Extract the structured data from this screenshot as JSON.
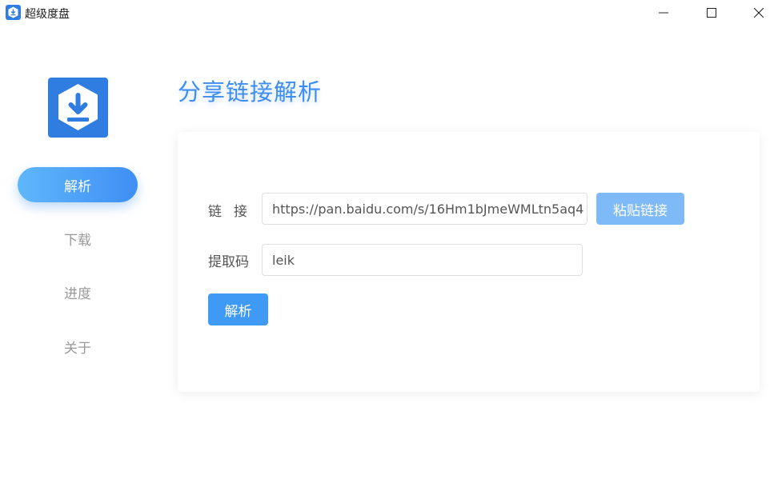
{
  "window": {
    "title": "超级度盘"
  },
  "sidebar": {
    "items": [
      {
        "label": "解析",
        "active": true
      },
      {
        "label": "下载",
        "active": false
      },
      {
        "label": "进度",
        "active": false
      },
      {
        "label": "关于",
        "active": false
      }
    ]
  },
  "main": {
    "title": "分享链接解析",
    "form": {
      "link_label": "链接",
      "link_value": "https://pan.baidu.com/s/16Hm1bJmeWMLtn5aq4",
      "paste_button": "粘贴链接",
      "code_label": "提取码",
      "code_value": "leik",
      "parse_button": "解析"
    }
  },
  "colors": {
    "accent": "#3f8ef4",
    "accent_light": "#7fbaf8",
    "nav_inactive": "#999999"
  },
  "icons": {
    "app": "download-icon",
    "minimize": "minimize-icon",
    "maximize": "maximize-icon",
    "close": "close-icon"
  }
}
